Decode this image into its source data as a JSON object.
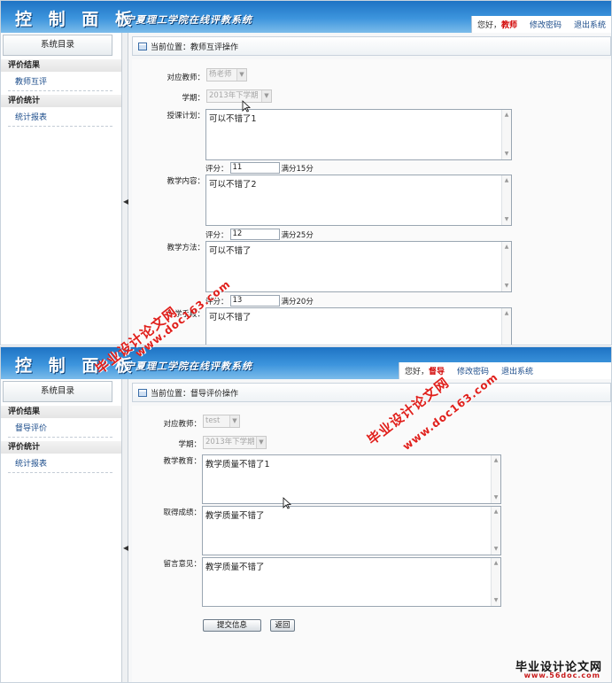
{
  "header": {
    "brand": "控 制 面 板",
    "school": "宁夏理工学院在线评教系统",
    "greeting": "您好，",
    "change_password": "修改密码",
    "logout": "退出系统"
  },
  "panes": [
    {
      "role": "教师",
      "sidebar": {
        "title": "系统目录",
        "group1": "评价结果",
        "item1": "教师互评",
        "group2": "评价统计",
        "item2": "统计报表"
      },
      "breadcrumb": "当前位置：教师互评操作",
      "teacher_label": "对应教师：",
      "teacher_value": "杨老师",
      "term_label": "学期：",
      "term_value": "2013年下学期",
      "fields": [
        {
          "label": "授课计划：",
          "text": "可以不错了1",
          "score_label": "评分：",
          "score": "11",
          "max": "满分15分"
        },
        {
          "label": "教学内容：",
          "text": "可以不错了2",
          "score_label": "评分：",
          "score": "12",
          "max": "满分25分"
        },
        {
          "label": "教学方法：",
          "text": "可以不错了",
          "score_label": "评分：",
          "score": "13",
          "max": "满分20分"
        },
        {
          "label": "教学手段：",
          "text": "可以不错了"
        }
      ]
    },
    {
      "role": "督导",
      "sidebar": {
        "title": "系统目录",
        "group1": "评价结果",
        "item1": "督导评价",
        "group2": "评价统计",
        "item2": "统计报表"
      },
      "breadcrumb": "当前位置：督导评价操作",
      "teacher_label": "对应教师：",
      "teacher_value": "test",
      "term_label": "学期：",
      "term_value": "2013年下学期",
      "fields": [
        {
          "label": "教学教育：",
          "text": "教学质量不错了1"
        },
        {
          "label": "取得成绩：",
          "text": "教学质量不错了"
        },
        {
          "label": "留言意见：",
          "text": "教学质量不错了"
        }
      ],
      "submit": "提交信息",
      "back": "返回"
    }
  ],
  "watermarks": {
    "cn": "毕业设计论文网",
    "url": "www.doc163.com"
  },
  "footer": {
    "site": "毕业设计论文网",
    "url": "www.56doc.com"
  },
  "colors": {
    "header_blue": "#1e73c4",
    "role_red": "#d10000",
    "link_blue": "#1a4b8a",
    "watermark_red": "#e0201c"
  }
}
